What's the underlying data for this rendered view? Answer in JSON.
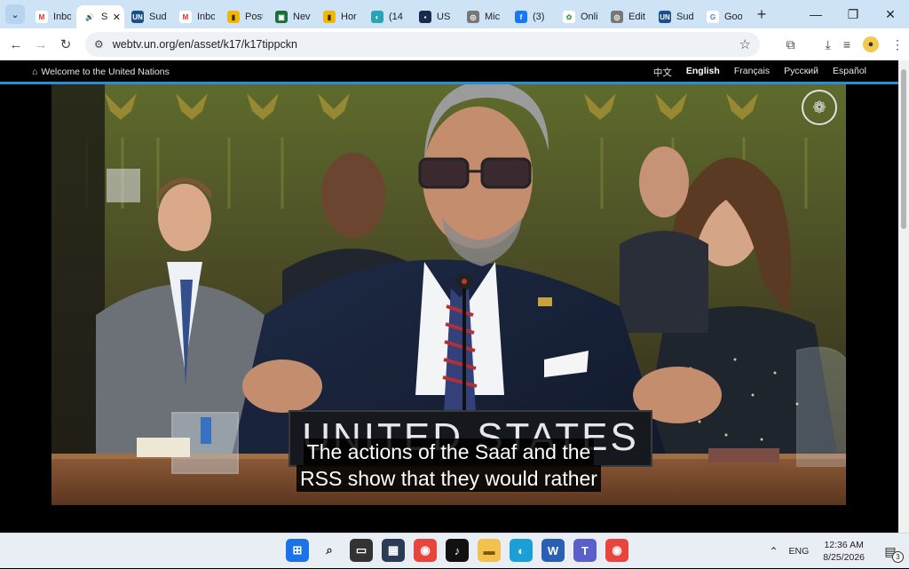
{
  "tabs": [
    {
      "label": "Inbo",
      "fav_text": "M",
      "fav_color": "#ffffff",
      "fav_fg": "#d93025"
    },
    {
      "label": "S",
      "fav_text": "🔊",
      "fav_color": "#ffffff",
      "fav_fg": "#333333",
      "active": true
    },
    {
      "label": "Sud",
      "fav_text": "UN",
      "fav_color": "#1a4f8b",
      "fav_fg": "#ffffff"
    },
    {
      "label": "Inbo",
      "fav_text": "M",
      "fav_color": "#ffffff",
      "fav_fg": "#d93025"
    },
    {
      "label": "Post",
      "fav_text": "▮",
      "fav_color": "#f2b705",
      "fav_fg": "#3a2a00"
    },
    {
      "label": "Nev",
      "fav_text": "▣",
      "fav_color": "#1b6e3a",
      "fav_fg": "#ffffff"
    },
    {
      "label": "Hor",
      "fav_text": "▮",
      "fav_color": "#f2b705",
      "fav_fg": "#3a2a00"
    },
    {
      "label": "(14",
      "fav_text": "◐",
      "fav_color": "#2aa3b5",
      "fav_fg": "#ffffff"
    },
    {
      "label": "US",
      "fav_text": "▪",
      "fav_color": "#1b2a4a",
      "fav_fg": "#ffffff"
    },
    {
      "label": "Mic",
      "fav_text": "◎",
      "fav_color": "#777777",
      "fav_fg": "#ffffff"
    },
    {
      "label": "(3)",
      "fav_text": "f",
      "fav_color": "#1877f2",
      "fav_fg": "#ffffff"
    },
    {
      "label": "Onli",
      "fav_text": "✿",
      "fav_color": "#ffffff",
      "fav_fg": "#3aa845"
    },
    {
      "label": "Edit",
      "fav_text": "◎",
      "fav_color": "#777777",
      "fav_fg": "#ffffff"
    },
    {
      "label": "Sud",
      "fav_text": "UN",
      "fav_color": "#1a4f8b",
      "fav_fg": "#ffffff"
    },
    {
      "label": "Goo",
      "fav_text": "G",
      "fav_color": "#ffffff",
      "fav_fg": "#4285f4"
    }
  ],
  "address": {
    "url": "webtv.un.org/en/asset/k17/k17tippckn"
  },
  "unbar": {
    "welcome": "Welcome to the United Nations",
    "languages": [
      "中文",
      "English",
      "Français",
      "Русский",
      "Español"
    ],
    "current": "English"
  },
  "video": {
    "caption_line1": "The actions of the Saaf and the",
    "caption_line2": "RSS show that they would rather",
    "nameplate": "UNITED STATES"
  },
  "taskbar": {
    "lang": "ENG",
    "time": "12:36 AM",
    "date": "8/25/2026",
    "notifications": "3"
  }
}
